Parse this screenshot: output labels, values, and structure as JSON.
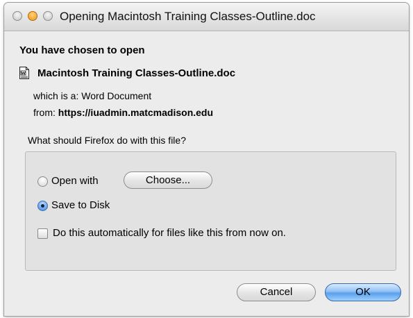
{
  "window": {
    "title": "Opening Macintosh Training Classes-Outline.doc"
  },
  "dialog": {
    "heading": "You have chosen to open",
    "file_icon": "word-document-icon",
    "filename": "Macintosh Training Classes-Outline.doc",
    "which_is_label": "which is a:",
    "which_is_value": "Word Document",
    "from_label": "from:",
    "from_value": "https://iuadmin.matcmadison.edu",
    "question": "What should Firefox do with this file?"
  },
  "options": {
    "open_with_label": "Open with",
    "choose_label": "Choose...",
    "save_to_disk_label": "Save to Disk",
    "selected": "save_to_disk",
    "auto_label": "Do this automatically for files like this from now on.",
    "auto_checked": false
  },
  "buttons": {
    "cancel_label": "Cancel",
    "ok_label": "OK"
  },
  "colors": {
    "accent": "#5aa0ea",
    "window_bg": "#ececec"
  }
}
